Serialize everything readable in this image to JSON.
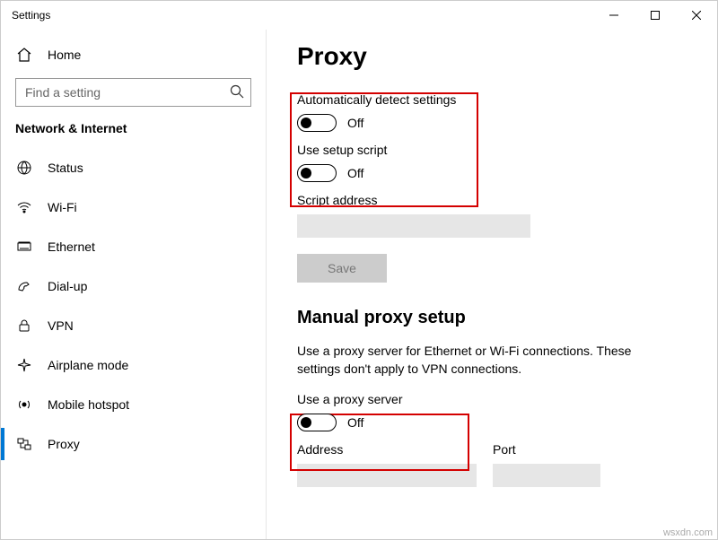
{
  "titlebar": {
    "title": "Settings"
  },
  "sidebar": {
    "home_label": "Home",
    "search_placeholder": "Find a setting",
    "section_header": "Network & Internet",
    "items": [
      {
        "label": "Status"
      },
      {
        "label": "Wi-Fi"
      },
      {
        "label": "Ethernet"
      },
      {
        "label": "Dial-up"
      },
      {
        "label": "VPN"
      },
      {
        "label": "Airplane mode"
      },
      {
        "label": "Mobile hotspot"
      },
      {
        "label": "Proxy"
      }
    ]
  },
  "main": {
    "heading": "Proxy",
    "auto_detect_label": "Automatically detect settings",
    "auto_detect_state": "Off",
    "use_script_label": "Use setup script",
    "use_script_state": "Off",
    "script_address_label": "Script address",
    "script_address_value": "",
    "save_label": "Save",
    "manual_heading": "Manual proxy setup",
    "manual_desc": "Use a proxy server for Ethernet or Wi-Fi connections. These settings don't apply to VPN connections.",
    "use_proxy_label": "Use a proxy server",
    "use_proxy_state": "Off",
    "address_label": "Address",
    "port_label": "Port"
  },
  "watermark": "wsxdn.com"
}
